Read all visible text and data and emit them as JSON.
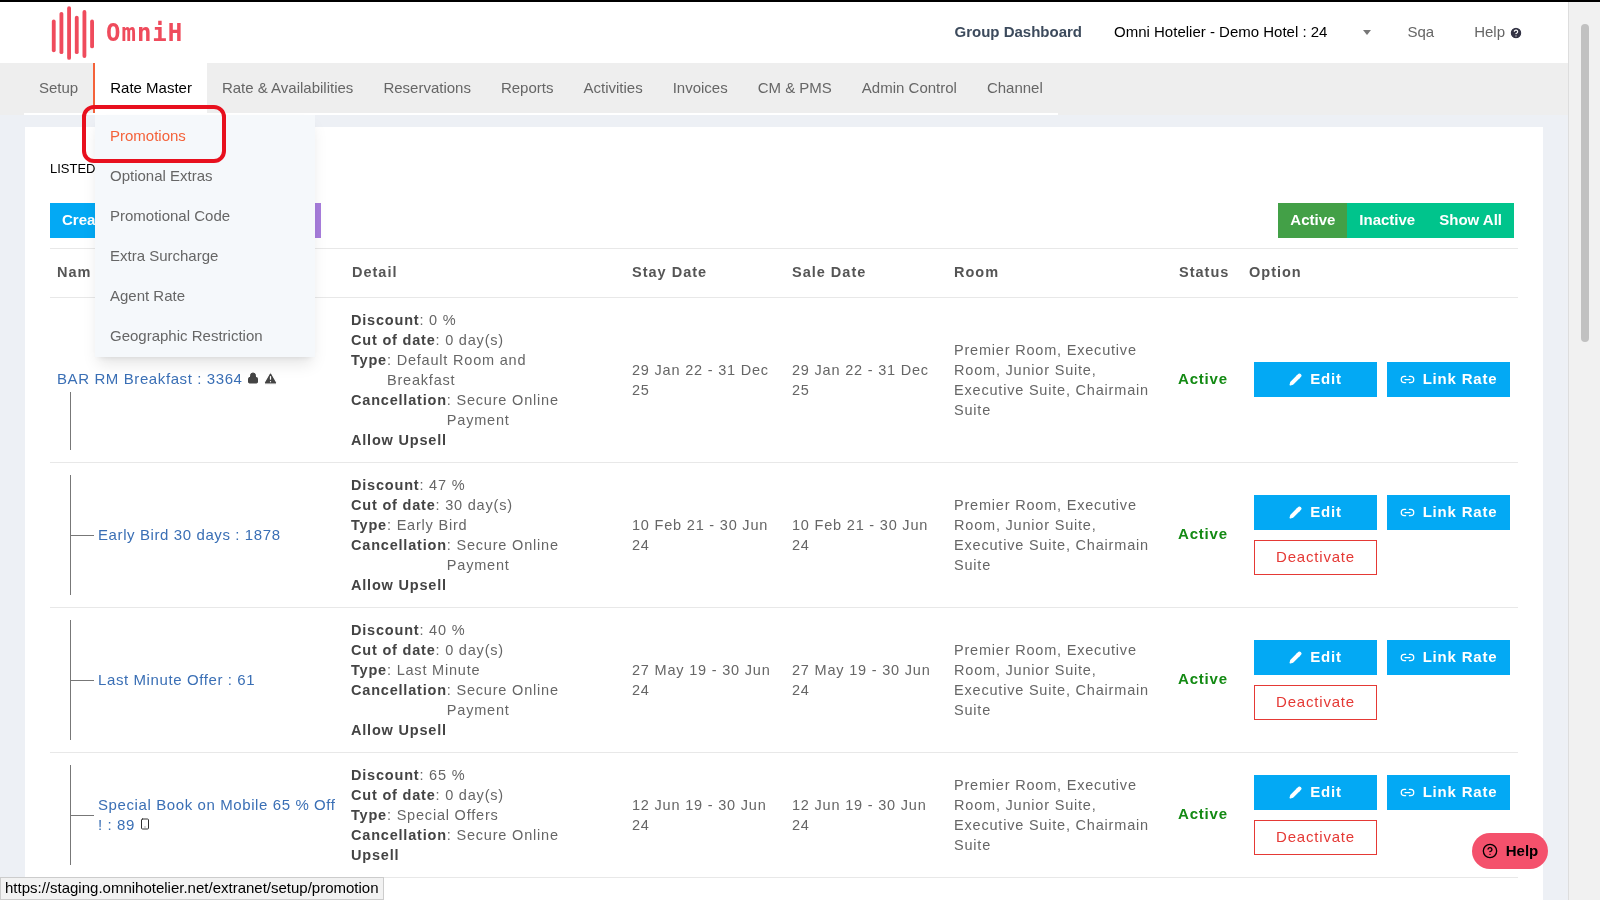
{
  "header": {
    "logo": "OmniH",
    "links": [
      {
        "kind": "dashboard",
        "label": "Group Dashboard"
      },
      {
        "kind": "hotel",
        "label": "Omni Hotelier - Demo Hotel : 24"
      },
      {
        "kind": "user",
        "label": "Sqa"
      },
      {
        "kind": "help",
        "label": "Help"
      }
    ]
  },
  "nav": [
    {
      "label": "Setup",
      "selected": false
    },
    {
      "label": "Rate Master",
      "selected": true
    },
    {
      "label": "Rate & Availabilities",
      "selected": false
    },
    {
      "label": "Reservations",
      "selected": false
    },
    {
      "label": "Reports",
      "selected": false
    },
    {
      "label": "Activities",
      "selected": false
    },
    {
      "label": "Invoices",
      "selected": false
    },
    {
      "label": "CM & PMS",
      "selected": false
    },
    {
      "label": "Admin Control",
      "selected": false
    },
    {
      "label": "Channel",
      "selected": false
    }
  ],
  "dropdown": {
    "items": [
      {
        "label": "Promotions",
        "selected": true,
        "highlighted": true
      },
      {
        "label": "Optional Extras",
        "selected": false,
        "highlighted": false
      },
      {
        "label": "Promotional Code",
        "selected": false,
        "highlighted": false
      },
      {
        "label": "Extra Surcharge",
        "selected": false,
        "highlighted": false
      },
      {
        "label": "Agent Rate",
        "selected": false,
        "highlighted": false
      },
      {
        "label": "Geographic Restriction",
        "selected": false,
        "highlighted": false
      }
    ]
  },
  "card": {
    "title": "LISTED",
    "create_button": "Crea",
    "filters": [
      {
        "label": "Active",
        "selected": true
      },
      {
        "label": "Inactive",
        "selected": false
      },
      {
        "label": "Show All",
        "selected": false
      }
    ],
    "table": {
      "columns": [
        "Nam",
        "Detail",
        "Stay Date",
        "Sale Date",
        "Room",
        "Status",
        "Option"
      ],
      "rows": [
        {
          "name": "BAR RM Breakfast : 3364",
          "locked": true,
          "warning": true,
          "mobile": false,
          "details": [
            {
              "label": "Discount",
              "sep": ":",
              "value": "0 %"
            },
            {
              "label": "Cut of date",
              "sep": ":",
              "value": "0 day(s)"
            },
            {
              "label": "Type",
              "sep": " :",
              "value": "Default Room and Breakfast"
            },
            {
              "label": "Cancellation",
              "sep": " :",
              "value": "Secure Online Payment"
            }
          ],
          "upsell": "Allow Upsell",
          "stay_date": "29 Jan 22 - 31 Dec 25",
          "sale_date": "29 Jan 22 - 31 Dec 25",
          "room": "Premier Room, Executive Room, Junior Suite, Executive Suite, Chairmain Suite",
          "status": "Active",
          "actions": [
            "Edit",
            "Link Rate"
          ],
          "deactivate": null,
          "children": [
            {
              "name": "Early Bird 30 days : 1878",
              "locked": false,
              "warning": false,
              "mobile": false,
              "details": [
                {
                  "label": "Discount",
                  "sep": ":",
                  "value": "47 %"
                },
                {
                  "label": "Cut of date",
                  "sep": ":",
                  "value": "30 day(s)"
                },
                {
                  "label": "Type",
                  "sep": " :",
                  "value": "Early Bird"
                },
                {
                  "label": "Cancellation",
                  "sep": " :",
                  "value": "Secure Online Payment"
                }
              ],
              "upsell": "Allow Upsell",
              "stay_date": "10 Feb 21 - 30 Jun 24",
              "sale_date": "10 Feb 21 - 30 Jun 24",
              "room": "Premier Room, Executive Room, Junior Suite, Executive Suite, Chairmain Suite",
              "status": "Active",
              "actions": [
                "Edit",
                "Link Rate"
              ],
              "deactivate": "Deactivate"
            },
            {
              "name": "Last Minute Offer : 61",
              "locked": false,
              "warning": false,
              "mobile": false,
              "details": [
                {
                  "label": "Discount",
                  "sep": ":",
                  "value": "40 %"
                },
                {
                  "label": "Cut of date",
                  "sep": ":",
                  "value": "0 day(s)"
                },
                {
                  "label": "Type",
                  "sep": " :",
                  "value": "Last Minute"
                },
                {
                  "label": "Cancellation",
                  "sep": " :",
                  "value": "Secure Online Payment"
                }
              ],
              "upsell": "Allow Upsell",
              "stay_date": "27 May 19 - 30 Jun 24",
              "sale_date": "27 May 19 - 30 Jun 24",
              "room": "Premier Room, Executive Room, Junior Suite, Executive Suite, Chairmain Suite",
              "status": "Active",
              "actions": [
                "Edit",
                "Link Rate"
              ],
              "deactivate": "Deactivate"
            },
            {
              "name": "Special Book on Mobile 65 % Off ! : 89",
              "locked": false,
              "warning": false,
              "mobile": true,
              "details": [
                {
                  "label": "Discount",
                  "sep": ":",
                  "value": "65 %"
                },
                {
                  "label": "Cut of date",
                  "sep": ":",
                  "value": "0 day(s)"
                },
                {
                  "label": "Type",
                  "sep": " :",
                  "value": "Special Offers"
                },
                {
                  "label": "Cancellation",
                  "sep": " :",
                  "value": "Secure Online"
                }
              ],
              "upsell": "Upsell",
              "stay_date": "12 Jun 19 - 30 Jun 24",
              "sale_date": "12 Jun 19 - 30 Jun 24",
              "room": "Premier Room, Executive Room, Junior Suite, Executive Suite, Chairmain Suite",
              "status": "Active",
              "actions": [
                "Edit",
                "Link Rate"
              ],
              "deactivate": "Deactivate"
            }
          ]
        }
      ]
    }
  },
  "help_button": "Help",
  "status_url": "https://staging.omnihotelier.net/extranet/setup/promotion"
}
